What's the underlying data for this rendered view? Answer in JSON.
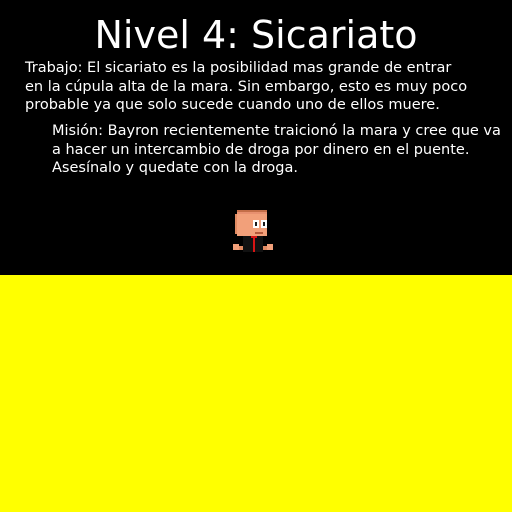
{
  "level": {
    "title": "Nivel 4: Sicariato"
  },
  "job": {
    "lines": [
      "Trabajo: El sicariato es la posibilidad mas grande de entrar",
      "en la cúpula alta de la mara. Sin embargo, esto es muy poco",
      "probable ya que solo sucede cuando uno de ellos muere."
    ]
  },
  "mission": {
    "lines": [
      "Misión: Bayron recientemente traicionó la mara y cree que va",
      "a hacer un intercambio de droga por dinero en el puente.",
      "Asesínalo y quedate con la droga."
    ]
  },
  "colors": {
    "background": "#000000",
    "text": "#ffffff",
    "ground": "#ffff00"
  },
  "sprite": {
    "name": "player-character"
  }
}
